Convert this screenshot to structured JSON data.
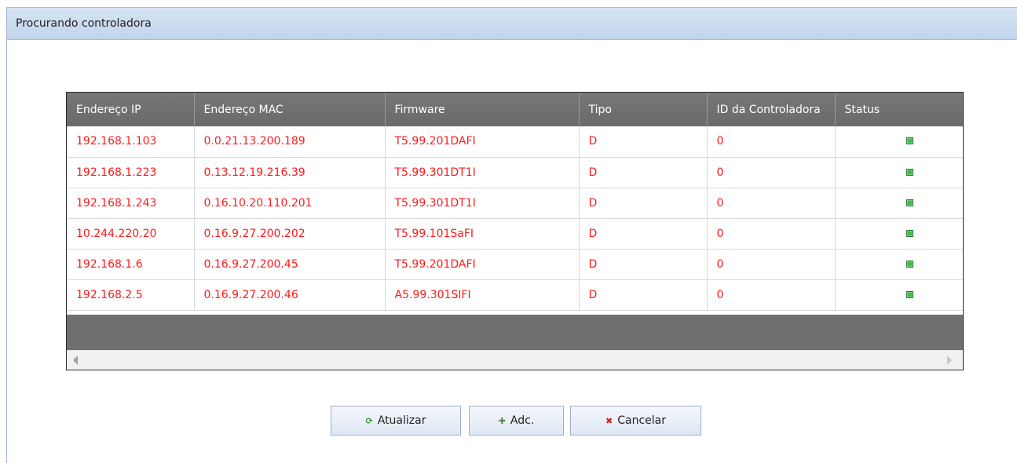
{
  "window": {
    "title": "Procurando controladora"
  },
  "table": {
    "columns": [
      "Endereço IP",
      "Endereço MAC",
      "Firmware",
      "Tipo",
      "ID da Controladora",
      "Status"
    ],
    "rows": [
      {
        "ip": "192.168.1.103",
        "mac": "0.0.21.13.200.189",
        "firmware": "T5.99.201DAFI",
        "tipo": "D",
        "id": "0",
        "status": "online"
      },
      {
        "ip": "192.168.1.223",
        "mac": "0.13.12.19.216.39",
        "firmware": "T5.99.301DT1I",
        "tipo": "D",
        "id": "0",
        "status": "online"
      },
      {
        "ip": "192.168.1.243",
        "mac": "0.16.10.20.110.201",
        "firmware": "T5.99.301DT1I",
        "tipo": "D",
        "id": "0",
        "status": "online"
      },
      {
        "ip": "10.244.220.20",
        "mac": "0.16.9.27.200.202",
        "firmware": "T5.99.101SaFI",
        "tipo": "D",
        "id": "0",
        "status": "online"
      },
      {
        "ip": "192.168.1.6",
        "mac": "0.16.9.27.200.45",
        "firmware": "T5.99.201DAFI",
        "tipo": "D",
        "id": "0",
        "status": "online"
      },
      {
        "ip": "192.168.2.5",
        "mac": "0.16.9.27.200.46",
        "firmware": "A5.99.301SIFI",
        "tipo": "D",
        "id": "0",
        "status": "online"
      }
    ]
  },
  "buttons": {
    "refresh": {
      "label": "Atualizar",
      "icon": "refresh-icon"
    },
    "add": {
      "label": "Adc.",
      "icon": "add-icon"
    },
    "cancel": {
      "label": "Cancelar",
      "icon": "cancel-icon"
    }
  },
  "colors": {
    "row_text": "#ff1a1a",
    "header_bg": "#6a6a6a",
    "title_bar_bg": "#c8d8ee",
    "status_ok": "#3cb64a"
  }
}
